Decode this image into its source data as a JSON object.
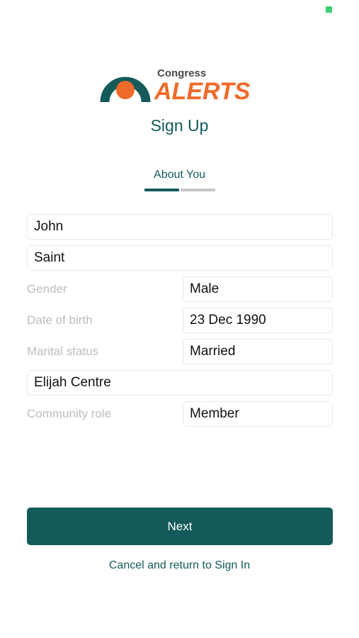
{
  "header": {
    "logo": {
      "top_text": "Congress",
      "main_text": "ALERTS",
      "colors": {
        "teal": "#145a5a",
        "orange": "#ef6b2a"
      }
    },
    "title": "Sign Up"
  },
  "step": {
    "label": "About You",
    "active_color": "#145a5a",
    "inactive_color": "#c7c7c7"
  },
  "form": {
    "first_name": {
      "value": "John"
    },
    "last_name": {
      "value": "Saint"
    },
    "gender": {
      "label": "Gender",
      "value": "Male"
    },
    "dob": {
      "label": "Date of birth",
      "value": "23 Dec 1990"
    },
    "marital": {
      "label": "Marital status",
      "value": "Married"
    },
    "community": {
      "value": "Elijah Centre"
    },
    "role": {
      "label": "Community role",
      "value": "Member"
    }
  },
  "actions": {
    "next_label": "Next",
    "cancel_label": "Cancel and return to Sign In",
    "primary_color": "#145a5a"
  },
  "status_bar": {
    "indicator_color": "#3bd16f"
  }
}
